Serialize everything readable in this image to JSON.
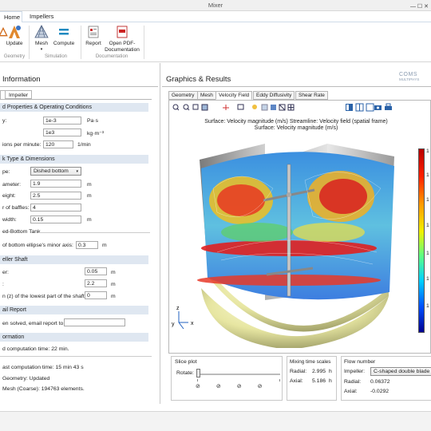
{
  "window": {
    "title": "Mixer",
    "controls": "—  ☐  ✕"
  },
  "menu": {
    "home_tab": "Home",
    "impellers_tab": "Impellers"
  },
  "ribbon": {
    "update_label": "Update",
    "mesh_label": "Mesh",
    "compute_label": "Compute",
    "report_label": "Report",
    "pdf_label_1": "Open PDF-",
    "pdf_label_2": "Documentation",
    "groups": {
      "geometry": "Geometry",
      "simulation": "Simulation",
      "documentation": "Documentation"
    }
  },
  "left": {
    "title": "Information",
    "subtab": "Impeller",
    "sec_props": "d Properties & Operating Conditions",
    "visc_label": "y:",
    "visc_value": "1e-3",
    "visc_unit": "Pa·s",
    "dens_value": "1e3",
    "dens_unit": "kg·m⁻³",
    "rpm_label": "ions per minute:",
    "rpm_value": "120",
    "rpm_unit": "1/min",
    "sec_tank": "k Type & Dimensions",
    "type_label": "pe:",
    "type_value": "Dished bottom",
    "diam_label": "ameter:",
    "diam_value": "1.9",
    "diam_unit": "m",
    "height_label": "eight:",
    "height_value": "2.5",
    "height_unit": "m",
    "baffles_label": "r of baffles:",
    "baffles_value": "4",
    "width_label": "width:",
    "width_value": "0.15",
    "width_unit": "m",
    "sub_dished": "ed-Bottom Tank",
    "minor_label": "of bottom ellipse's minor axis:",
    "minor_value": "0.3",
    "minor_unit": "m",
    "sec_shaft": "eller Shaft",
    "shaft1_label": "er:",
    "shaft1_value": "0.05",
    "shaft1_unit": "m",
    "shaft2_label": ":",
    "shaft2_value": "2.2",
    "shaft2_unit": "m",
    "shaft3_label": "n (z) of the lowest part of the shaft:",
    "shaft3_value": "0",
    "shaft3_unit": "m",
    "sec_email": "ail Report",
    "email_label": "en solved, email report to:",
    "email_value": "",
    "sec_info": "ormation",
    "est_time": "d computation time:   22 min.",
    "last_time": "ast computation time: 15 min 43 s",
    "geom_status": "Geometry: Updated",
    "mesh_status": "Mesh (Coarse): 194763 elements."
  },
  "right": {
    "title": "Graphics & Results",
    "logo_line1": "COMS",
    "logo_line2": "MULTIPHYS",
    "tabs": [
      "Geometry",
      "Mesh",
      "Velocity Field",
      "Eddy Diffusivity",
      "Shear Rate"
    ],
    "plot_line1": "Surface: Velocity magnitude (m/s)   Streamline: Velocity field (spatial frame)",
    "plot_line2": "Surface: Velocity magnitude (m/s)",
    "colorbar_ticks": [
      "1",
      "1",
      "1",
      "1",
      "1",
      "1",
      "1"
    ],
    "axes": {
      "y": "y",
      "z": "z",
      "x": "x"
    }
  },
  "slice": {
    "title": "Slice plot",
    "rotate_label": "Rotate:",
    "rotate_fraction": 0.0
  },
  "mixing": {
    "title": "Mixing time scales",
    "radial_label": "Radial:",
    "radial_value": "2.995",
    "radial_unit": "h",
    "axial_label": "Axial:",
    "axial_value": "5.186",
    "axial_unit": "h"
  },
  "flow": {
    "title": "Flow number",
    "impeller_label": "Impeller:",
    "impeller_value": "C-shaped double blade",
    "radial_label": "Radial:",
    "radial_value": "0.06372",
    "axial_label": "Axial:",
    "axial_value": "-0.0292"
  },
  "colors": {
    "section_bg": "#dfe7f1",
    "accent": "#2a62a8"
  }
}
